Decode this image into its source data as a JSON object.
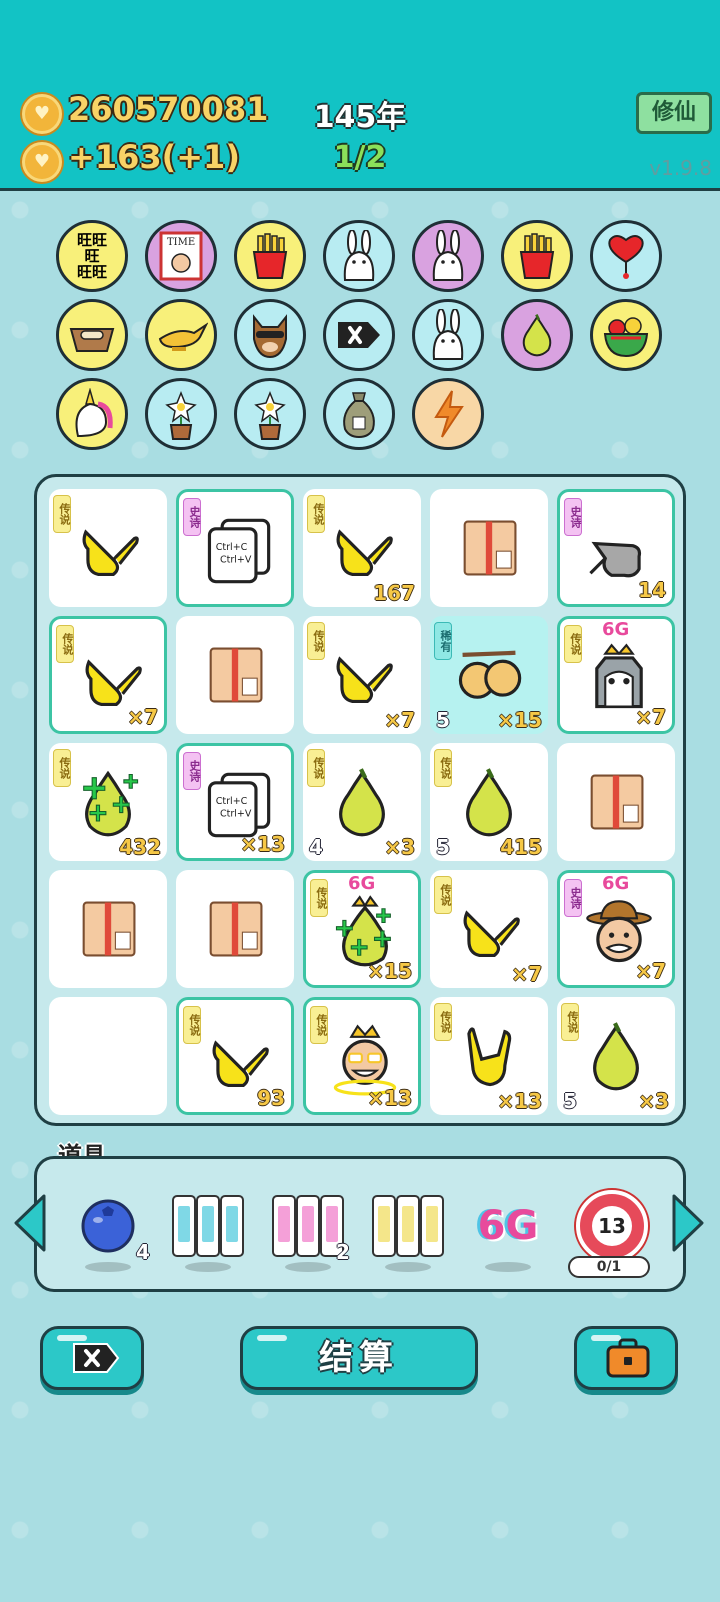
{
  "header": {
    "coins": "260570081",
    "income": "+163(+1)",
    "year": "145年",
    "turn": "1/2",
    "xiuxian_label": "修仙",
    "version": "v1.9.8"
  },
  "icon_strip": [
    {
      "name": "wang-tile-icon",
      "bg": "#f8f07a"
    },
    {
      "name": "time-magazine-icon",
      "bg": "#d9a2e0"
    },
    {
      "name": "fries-icon",
      "bg": "#f8f07a"
    },
    {
      "name": "rabbit-icon",
      "bg": "#b8ecf2"
    },
    {
      "name": "rabbit-icon",
      "bg": "#d9a2e0"
    },
    {
      "name": "fries-icon",
      "bg": "#f8f07a"
    },
    {
      "name": "heart-drip-icon",
      "bg": "#b8ecf2"
    },
    {
      "name": "pet-bowl-icon",
      "bg": "#f8f07a"
    },
    {
      "name": "magic-lamp-icon",
      "bg": "#f8f07a"
    },
    {
      "name": "cool-dog-icon",
      "bg": "#b8ecf2"
    },
    {
      "name": "delete-tag-icon",
      "bg": "#b8ecf2"
    },
    {
      "name": "rabbit-icon",
      "bg": "#b8ecf2"
    },
    {
      "name": "pomelo-icon",
      "bg": "#d9a2e0"
    },
    {
      "name": "fruit-basket-icon",
      "bg": "#f8f07a"
    },
    {
      "name": "unicorn-icon",
      "bg": "#f8f07a"
    },
    {
      "name": "flower-pot-icon",
      "bg": "#b8ecf2"
    },
    {
      "name": "flower-pot-icon",
      "bg": "#b8ecf2"
    },
    {
      "name": "money-bag-icon",
      "bg": "#b8ecf2"
    },
    {
      "name": "lightning-icon",
      "bg": "#f8d7a6"
    }
  ],
  "board": [
    {
      "icon": "hand-point-icon",
      "tag": "传说",
      "tier": "leg",
      "count": "",
      "level": "",
      "hl": false
    },
    {
      "icon": "copy-paste-icon",
      "tag": "史诗",
      "tier": "epic",
      "count": "",
      "level": "",
      "hl": true
    },
    {
      "icon": "hand-point-icon",
      "tag": "传说",
      "tier": "leg",
      "count": "167",
      "level": "",
      "hl": false
    },
    {
      "icon": "parcel-box-icon",
      "tag": "",
      "tier": "",
      "count": "",
      "level": "",
      "hl": false
    },
    {
      "icon": "grey-hand-icon",
      "tag": "史诗",
      "tier": "epic",
      "count": "14",
      "level": "",
      "hl": true
    },
    {
      "icon": "hand-point-icon",
      "tag": "传说",
      "tier": "leg",
      "count": "×7",
      "level": "",
      "hl": true
    },
    {
      "icon": "parcel-box-icon",
      "tag": "",
      "tier": "",
      "count": "",
      "level": "",
      "hl": false
    },
    {
      "icon": "hand-point-icon",
      "tag": "传说",
      "tier": "leg",
      "count": "×7",
      "level": "",
      "hl": false
    },
    {
      "icon": "twin-fruit-icon",
      "tag": "稀有",
      "tier": "rare",
      "count": "×15",
      "level": "5",
      "hl": false,
      "cyan": true
    },
    {
      "icon": "husky-king-icon",
      "tag": "传说",
      "tier": "leg",
      "count": "×7",
      "level": "",
      "hl": true,
      "sixg": "6G"
    },
    {
      "icon": "pomelo-sparkle-icon",
      "tag": "传说",
      "tier": "leg",
      "count": "432",
      "level": "",
      "hl": false
    },
    {
      "icon": "copy-paste-icon",
      "tag": "史诗",
      "tier": "epic",
      "count": "×13",
      "level": "",
      "hl": true
    },
    {
      "icon": "pomelo-icon",
      "tag": "传说",
      "tier": "leg",
      "count": "×3",
      "level": "4",
      "hl": false
    },
    {
      "icon": "pomelo-icon",
      "tag": "传说",
      "tier": "leg",
      "count": "415",
      "level": "5",
      "hl": false
    },
    {
      "icon": "parcel-box-icon",
      "tag": "",
      "tier": "",
      "count": "",
      "level": "",
      "hl": false
    },
    {
      "icon": "parcel-box-icon",
      "tag": "",
      "tier": "",
      "count": "",
      "level": "",
      "hl": false
    },
    {
      "icon": "parcel-box-icon",
      "tag": "",
      "tier": "",
      "count": "",
      "level": "",
      "hl": false
    },
    {
      "icon": "pomelo-king-icon",
      "tag": "传说",
      "tier": "leg",
      "count": "×15",
      "level": "",
      "hl": true,
      "sixg": "6G"
    },
    {
      "icon": "hand-point-icon",
      "tag": "传说",
      "tier": "leg",
      "count": "×7",
      "level": "",
      "hl": false
    },
    {
      "icon": "old-man-hat-icon",
      "tag": "史诗",
      "tier": "epic",
      "count": "×7",
      "level": "",
      "hl": true,
      "sixg": "6G"
    },
    {
      "icon": "empty-slot-icon",
      "tag": "",
      "tier": "",
      "count": "",
      "level": "",
      "hl": false
    },
    {
      "icon": "hand-point-icon",
      "tag": "传说",
      "tier": "leg",
      "count": "93",
      "level": "",
      "hl": true
    },
    {
      "icon": "king-face-icon",
      "tag": "传说",
      "tier": "leg",
      "count": "×13",
      "level": "",
      "hl": true
    },
    {
      "icon": "rock-hand-icon",
      "tag": "传说",
      "tier": "leg",
      "count": "×13",
      "level": "",
      "hl": false
    },
    {
      "icon": "pomelo-icon",
      "tag": "传说",
      "tier": "leg",
      "count": "×3",
      "level": "5",
      "hl": false
    }
  ],
  "tools": {
    "title": "道具",
    "items": [
      {
        "icon": "blueberry-icon",
        "count": "4"
      },
      {
        "icon": "rare-cards-icon",
        "count": ""
      },
      {
        "icon": "epic-cards-icon",
        "count": "2"
      },
      {
        "icon": "legend-cards-icon",
        "count": ""
      },
      {
        "icon": "six-g-icon",
        "label": "6G",
        "count": ""
      },
      {
        "icon": "target-13-icon",
        "label": "13",
        "count": ""
      }
    ],
    "progress": "0/1"
  },
  "bottom": {
    "settle_label": "结算"
  },
  "colors": {
    "teal": "#12c3c5",
    "gold": "#f8d366",
    "legend_tag": "#f9ef94",
    "epic_tag": "#f4c2f2",
    "rare_tag": "#8fe8e4"
  }
}
